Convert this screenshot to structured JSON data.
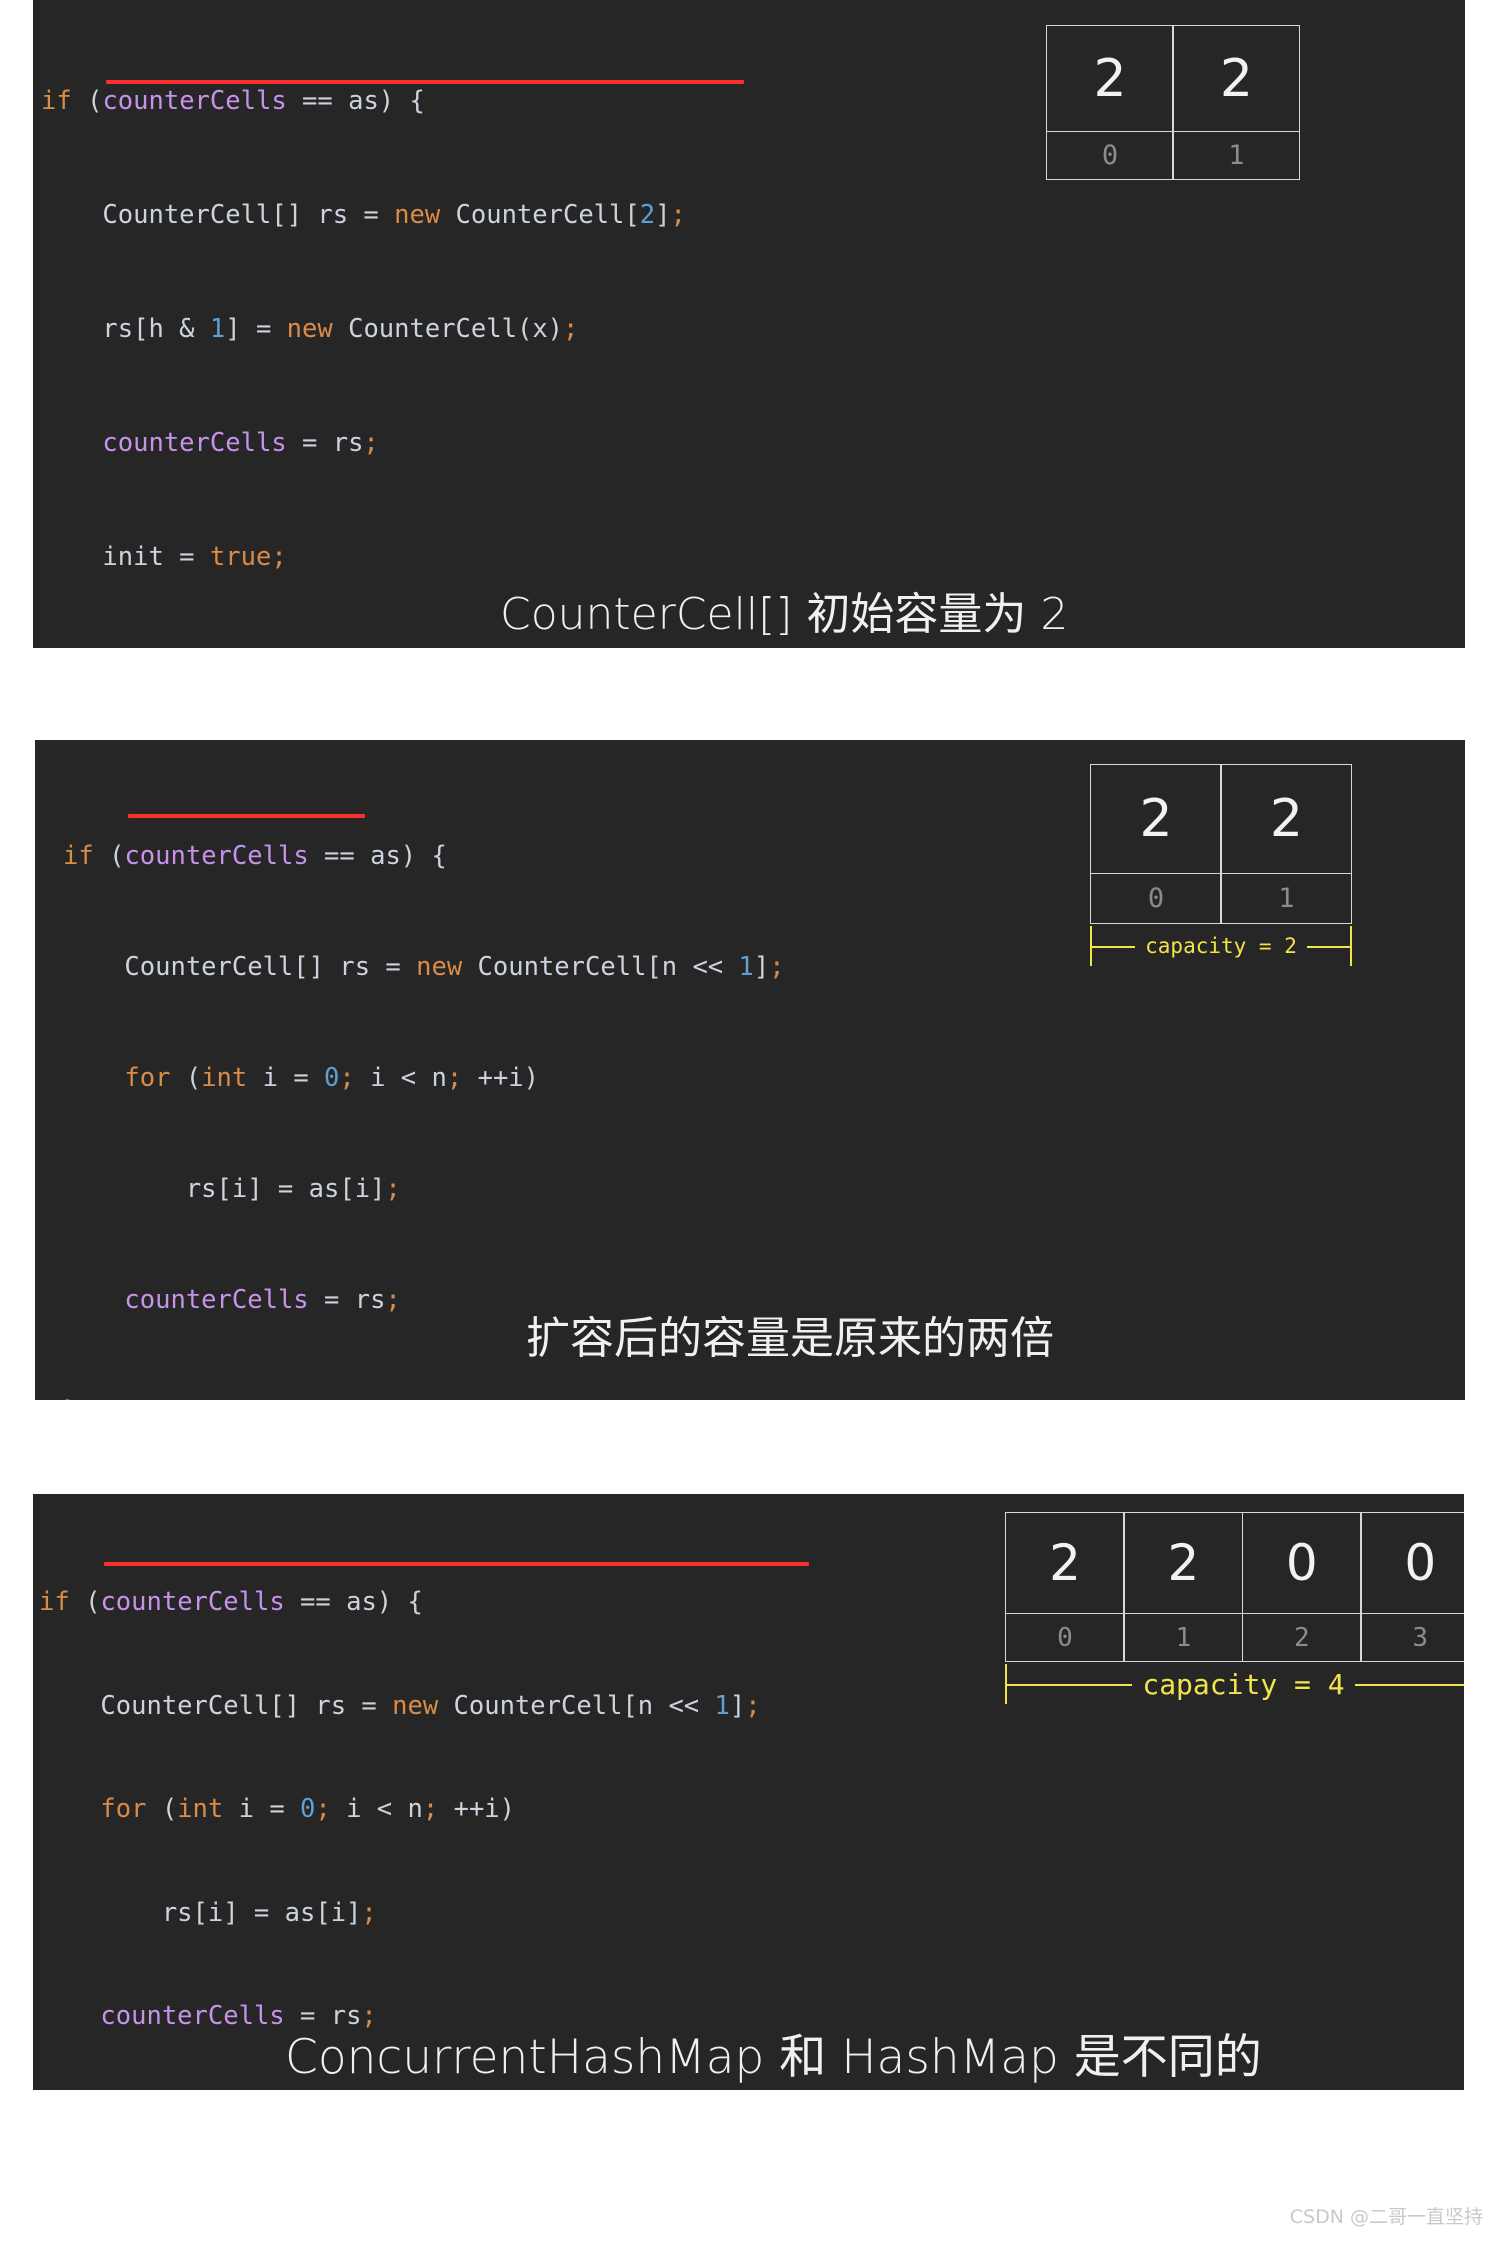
{
  "panels": [
    {
      "id": "panel-1",
      "code_lines": [
        "if (counterCells == as) {",
        "    CounterCell[] rs = new CounterCell[2];",
        "    rs[h & 1] = new CounterCell(x);",
        "    counterCells = rs;",
        "    init = true;",
        "}"
      ],
      "annotation": "red-underline-under-counterCell-array-declaration",
      "array": {
        "values": [
          "2",
          "2"
        ],
        "indices": [
          "0",
          "1"
        ],
        "capacity_label": null
      },
      "caption": "CounterCell[] 初始容量为 2"
    },
    {
      "id": "panel-2",
      "code_lines": [
        "if (counterCells == as) {",
        "    CounterCell[] rs = new CounterCell[n << 1];",
        "    for (int i = 0; i < n; ++i)",
        "        rs[i] = as[i];",
        "    counterCells = rs;",
        "}"
      ],
      "annotation": "red-underline-under-CounterCell[]-type",
      "array": {
        "values": [
          "2",
          "2"
        ],
        "indices": [
          "0",
          "1"
        ],
        "capacity_label": "capacity = 2"
      },
      "caption": "扩容后的容量是原来的两倍"
    },
    {
      "id": "panel-3",
      "code_lines": [
        "if (counterCells == as) {",
        "    CounterCell[] rs = new CounterCell[n << 1];",
        "    for (int i = 0; i < n; ++i)",
        "        rs[i] = as[i];",
        "    counterCells = rs;",
        "}"
      ],
      "annotation": "red-underline-under-full-declaration-line",
      "array": {
        "values": [
          "2",
          "2",
          "0",
          "0"
        ],
        "indices": [
          "0",
          "1",
          "2",
          "3"
        ],
        "capacity_label": "capacity = 4"
      },
      "caption": "ConcurrentHashMap 和 HashMap 是不同的"
    }
  ],
  "watermark": "CSDN @二哥一直坚持",
  "colors": {
    "panel_background": "#262626",
    "page_background": "#ffffff",
    "code_default": "#cdd3de",
    "keyword": "#d98b47",
    "field": "#c792ea",
    "number": "#5f9fd4",
    "underline": "#fb2e2e",
    "cell_border": "#d8d8d8",
    "cell_value": "#f2f2f2",
    "cell_index": "#8c8c8c",
    "capacity": "#f2e34c",
    "caption": "#f0f0f0"
  }
}
